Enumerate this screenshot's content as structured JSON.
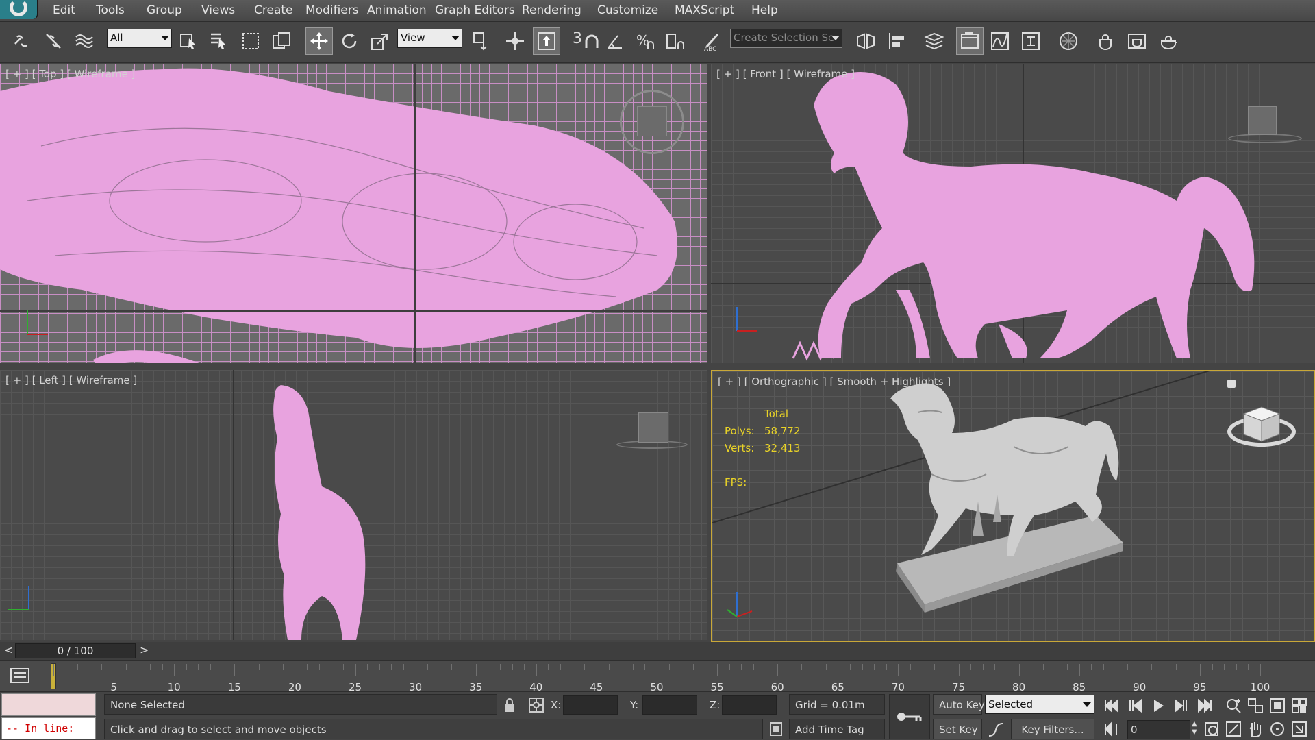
{
  "menu": {
    "items": [
      "Edit",
      "Tools",
      "Group",
      "Views",
      "Create",
      "Modifiers",
      "Animation",
      "Graph Editors",
      "Rendering",
      "Customize",
      "MAXScript",
      "Help"
    ]
  },
  "toolbar": {
    "selection_filter": "All",
    "reference_coord": "View",
    "snap_label": "3",
    "named_selection_placeholder": "Create Selection Se",
    "icons": [
      "link-icon",
      "unlink-icon",
      "bind-space-warp-icon",
      "select-object-icon",
      "select-by-name-icon",
      "rect-region-icon",
      "window-crossing-icon",
      "move-icon",
      "rotate-icon",
      "scale-icon",
      "pivot-icon",
      "manipulate-icon",
      "keyboard-shortcut-icon",
      "snap-icon",
      "angle-snap-icon",
      "percent-snap-icon",
      "spinner-snap-icon",
      "edit-named-selection-icon",
      "mirror-icon",
      "align-icon",
      "layer-explorer-icon",
      "scene-explorer-icon",
      "curve-editor-icon",
      "schematic-view-icon",
      "material-editor-icon",
      "render-setup-icon",
      "rendered-frame-window-icon",
      "render-production-icon"
    ]
  },
  "viewports": {
    "top": {
      "label": "[ + ] [ Top ] [ Wireframe ]"
    },
    "front": {
      "label": "[ + ] [ Front ] [ Wireframe ]"
    },
    "left": {
      "label": "[ + ] [ Left ] [ Wireframe ]"
    },
    "ortho": {
      "label": "[ + ] [ Orthographic ] [ Smooth + Highlights ]",
      "stats_header": "Total",
      "polys_label": "Polys:",
      "polys_value": "58,772",
      "verts_label": "Verts:",
      "verts_value": "32,413",
      "fps_label": "FPS:"
    }
  },
  "timeline": {
    "frame_display": "0 / 100",
    "prev": "<",
    "next": ">",
    "ticks": [
      "5",
      "10",
      "15",
      "20",
      "25",
      "30",
      "35",
      "40",
      "45",
      "50",
      "55",
      "60",
      "65",
      "70",
      "75",
      "80",
      "85",
      "90",
      "95",
      "100"
    ]
  },
  "status": {
    "maxscript_prompt": "-- In line:",
    "selection_info": "None Selected",
    "prompt": "Click and drag to select and move objects",
    "x_label": "X:",
    "y_label": "Y:",
    "z_label": "Z:",
    "grid": "Grid = 0.01m",
    "add_time_tag": "Add Time Tag",
    "auto_key": "Auto Key",
    "set_key": "Set Key",
    "key_mode": "Selected",
    "key_filters": "Key Filters...",
    "current_frame": "0"
  },
  "colors": {
    "wireframe_pink": "#e8a3df",
    "active_viewport_border": "#c9a838",
    "stats_yellow": "#e9d327"
  }
}
